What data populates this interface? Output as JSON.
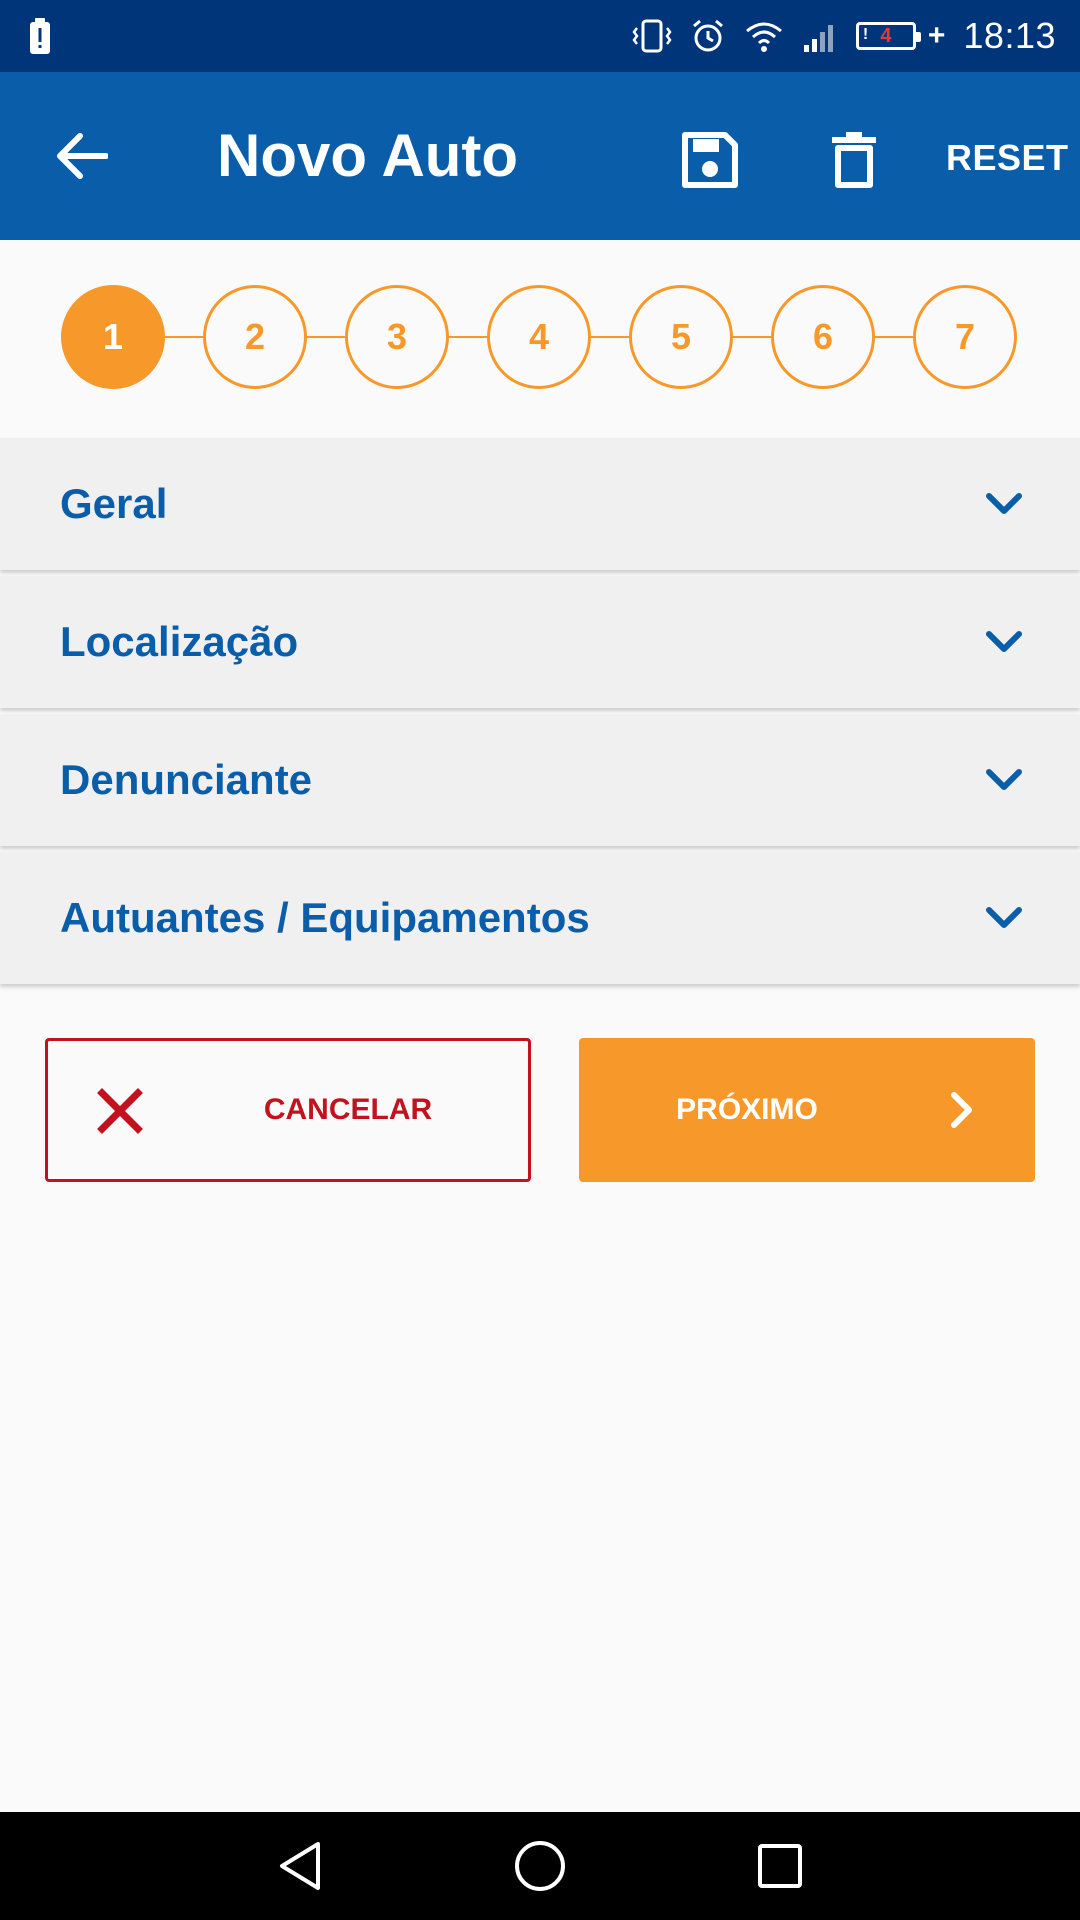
{
  "status_bar": {
    "time": "18:13",
    "battery_level": "4",
    "battery_warning": "!",
    "charging": "+",
    "icons": [
      "battery-alert-icon",
      "vibrate-icon",
      "alarm-icon",
      "wifi-icon",
      "signal-icon",
      "battery-icon"
    ]
  },
  "app_bar": {
    "title": "Novo Auto",
    "reset_label": "RESET",
    "icons": [
      "back-arrow-icon",
      "save-icon",
      "delete-icon"
    ]
  },
  "stepper": {
    "steps": [
      "1",
      "2",
      "3",
      "4",
      "5",
      "6",
      "7"
    ],
    "active_step": "1"
  },
  "sections": [
    {
      "label": "Geral"
    },
    {
      "label": "Localização"
    },
    {
      "label": "Denunciante"
    },
    {
      "label": "Autuantes / Equipamentos"
    }
  ],
  "actions": {
    "cancel_label": "CANCELAR",
    "next_label": "PRÓXIMO"
  },
  "nav_bar": {
    "icons": [
      "back-triangle-icon",
      "home-circle-icon",
      "recents-square-icon"
    ]
  },
  "colors": {
    "status_bar": "#003579",
    "app_bar": "#0a5ea9",
    "accent_orange": "#f7992a",
    "cancel_red": "#c1121f",
    "section_background": "#f0f0f0",
    "background": "#fafafa"
  }
}
